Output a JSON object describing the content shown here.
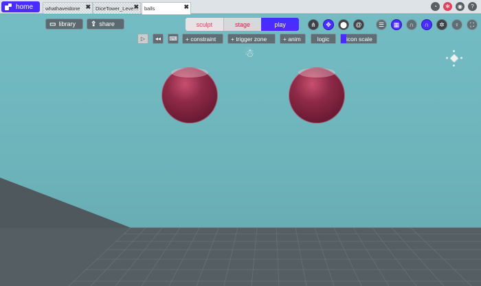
{
  "tabbar": {
    "home_label": "home",
    "tabs": [
      {
        "label": "whathaveidone",
        "active": false
      },
      {
        "label": "DiceTower_Leve…",
        "active": false
      },
      {
        "label": "balls",
        "active": true
      }
    ],
    "close_glyph": "✖",
    "system_icons": [
      "speedometer-icon",
      "settings-gear-icon",
      "discord-icon",
      "help-icon"
    ],
    "settings_color": "#e0415c"
  },
  "toolbar": {
    "library_label": "library",
    "share_label": "share",
    "modes": {
      "sculpt": "sculpt",
      "stage": "stage",
      "play": "play"
    },
    "active_mode": "play",
    "play_tools": {
      "constraint_label": "+ constraint",
      "trigger_zone_label": "+ trigger zone",
      "anim_label": "+ anim",
      "logic_label": "logic",
      "icon_scale_label": "icon scale"
    },
    "right_icons": [
      "tree-hierarchy-icon",
      "move-arrows-icon",
      "sphere-nodes-icon",
      "spiral-icon",
      "list-icon",
      "grid-icon",
      "magnet-icon",
      "magnet-active-icon",
      "film-reel-icon",
      "globe-icon",
      "lightbulb-icon",
      "fullscreen-icon"
    ]
  },
  "colors": {
    "accent": "#4a2cff",
    "sky": "#6fb6bd",
    "ground": "#545d61",
    "sphere": "#8e2a48"
  }
}
